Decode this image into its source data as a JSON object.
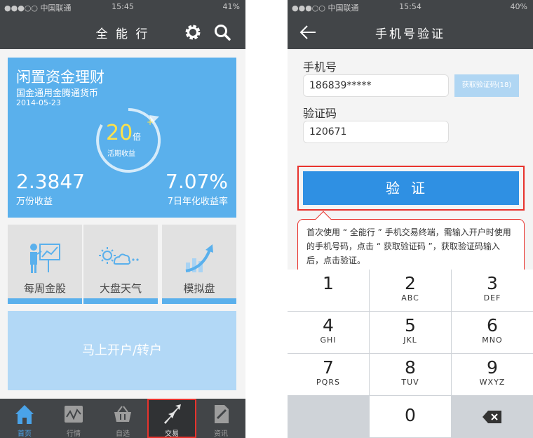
{
  "left_phone": {
    "status": {
      "carrier": "●●●○○ 中国联通",
      "time": "15:45",
      "battery": "41%"
    },
    "nav_title": "全 能 行",
    "hero": {
      "title": "闲置资金理财",
      "subtitle": "国金通用金腾通货币",
      "date": "2014-05-23",
      "multiplier": "20",
      "multiplier_unit": "倍",
      "multiplier_label": "活期收益",
      "value1": "2.3847",
      "label1": "万份收益",
      "value2": "7.07%",
      "label2": "7日年化收益率"
    },
    "tiles": [
      {
        "label": "每周金股",
        "icon": "presenter-chart-icon"
      },
      {
        "label": "大盘天气",
        "icon": "weather-icon"
      },
      {
        "label": "模拟盘",
        "icon": "growth-chart-icon"
      }
    ],
    "open_button": "马上开户/转户",
    "tabs": [
      {
        "label": "首页",
        "icon": "home-icon"
      },
      {
        "label": "行情",
        "icon": "quotes-icon"
      },
      {
        "label": "自选",
        "icon": "basket-icon"
      },
      {
        "label": "交易",
        "icon": "trade-arrows-icon"
      },
      {
        "label": "资讯",
        "icon": "news-icon"
      }
    ]
  },
  "right_phone": {
    "status": {
      "carrier": "●●●○○ 中国联通",
      "time": "15:54",
      "battery": "40%"
    },
    "nav_title": "手机号验证",
    "phone_label": "手机号",
    "phone_value": "186839*****",
    "get_code_button": "获取验证码(18)",
    "code_label": "验证码",
    "code_value": "120671",
    "verify_button": "验证",
    "tooltip": "首次使用 “ 全能行 ” 手机交易终端，需输入开户时使用的手机号码，点击 “ 获取验证码 ”，获取验证码输入后，点击验证。",
    "keys": [
      {
        "num": "1",
        "letters": ""
      },
      {
        "num": "2",
        "letters": "ABC"
      },
      {
        "num": "3",
        "letters": "DEF"
      },
      {
        "num": "4",
        "letters": "GHI"
      },
      {
        "num": "5",
        "letters": "JKL"
      },
      {
        "num": "6",
        "letters": "MNO"
      },
      {
        "num": "7",
        "letters": "PQRS"
      },
      {
        "num": "8",
        "letters": "TUV"
      },
      {
        "num": "9",
        "letters": "WXYZ"
      },
      {
        "num": "0",
        "letters": ""
      }
    ]
  }
}
